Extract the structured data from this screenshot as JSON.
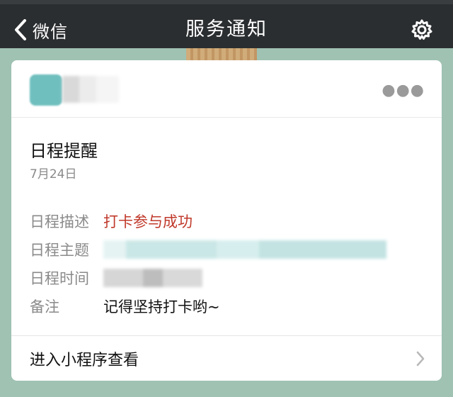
{
  "nav": {
    "back_label": "微信",
    "title": "服务通知"
  },
  "card": {
    "title": "日程提醒",
    "date": "7月24日",
    "fields": [
      {
        "key": "日程描述",
        "value": "打卡参与成功"
      },
      {
        "key": "日程主题",
        "value": ""
      },
      {
        "key": "日程时间",
        "value": ""
      },
      {
        "key": "备注",
        "value": "记得坚持打卡哟~"
      }
    ],
    "footer_label": "进入小程序查看"
  },
  "colors": {
    "navbar": "#2b2e30",
    "background": "#9fc2b3",
    "highlight_red": "#c0392b"
  }
}
